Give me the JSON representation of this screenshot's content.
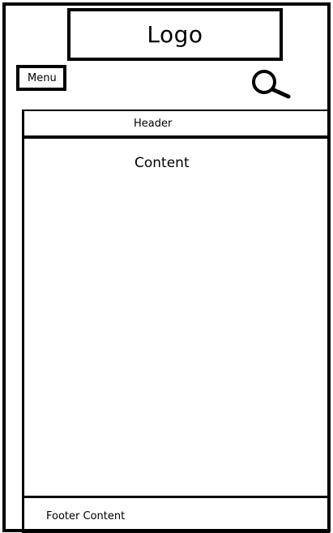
{
  "logo": {
    "label": "Logo"
  },
  "toolbar": {
    "menu_label": "Menu",
    "search_icon": "search-icon"
  },
  "panel": {
    "header_label": "Header",
    "content_label": "Content",
    "footer_label": "Footer Content"
  },
  "colors": {
    "line": "#000000",
    "background": "#ffffff"
  }
}
